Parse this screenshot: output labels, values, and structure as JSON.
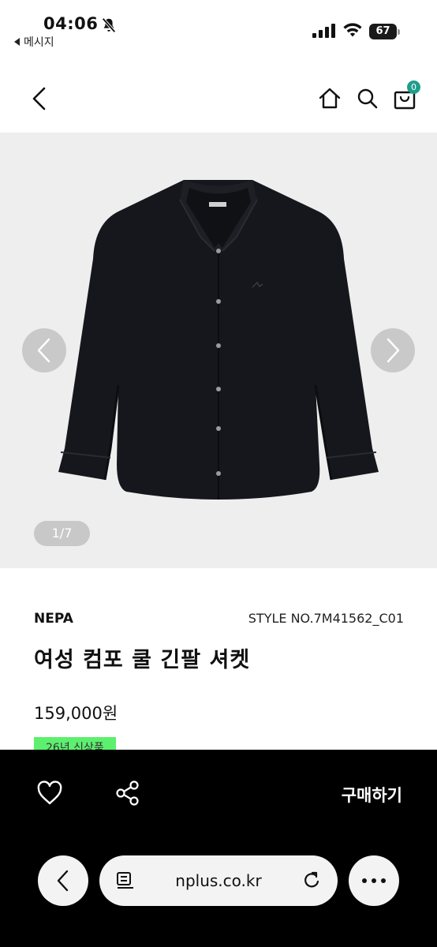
{
  "status_bar": {
    "time": "04:06",
    "back_app_label": "메시지",
    "battery_level": "67"
  },
  "header": {
    "cart_count": "0"
  },
  "gallery": {
    "pager": "1/7",
    "current_image": 1,
    "total_images": 7
  },
  "product": {
    "brand": "NEPA",
    "style_no": "STYLE NO.7M41562_C01",
    "name": "여성 컴포 쿨 긴팔 셔켓",
    "price": "159,000원",
    "tag": "26년 신상품"
  },
  "action_bar": {
    "buy_label": "구매하기"
  },
  "browser": {
    "url": "nplus.co.kr"
  },
  "colors": {
    "accent_teal": "#1f9e8b",
    "tag_green": "#5cf06e",
    "gallery_bg": "#eeeeee",
    "action_bar_bg": "#000000"
  }
}
